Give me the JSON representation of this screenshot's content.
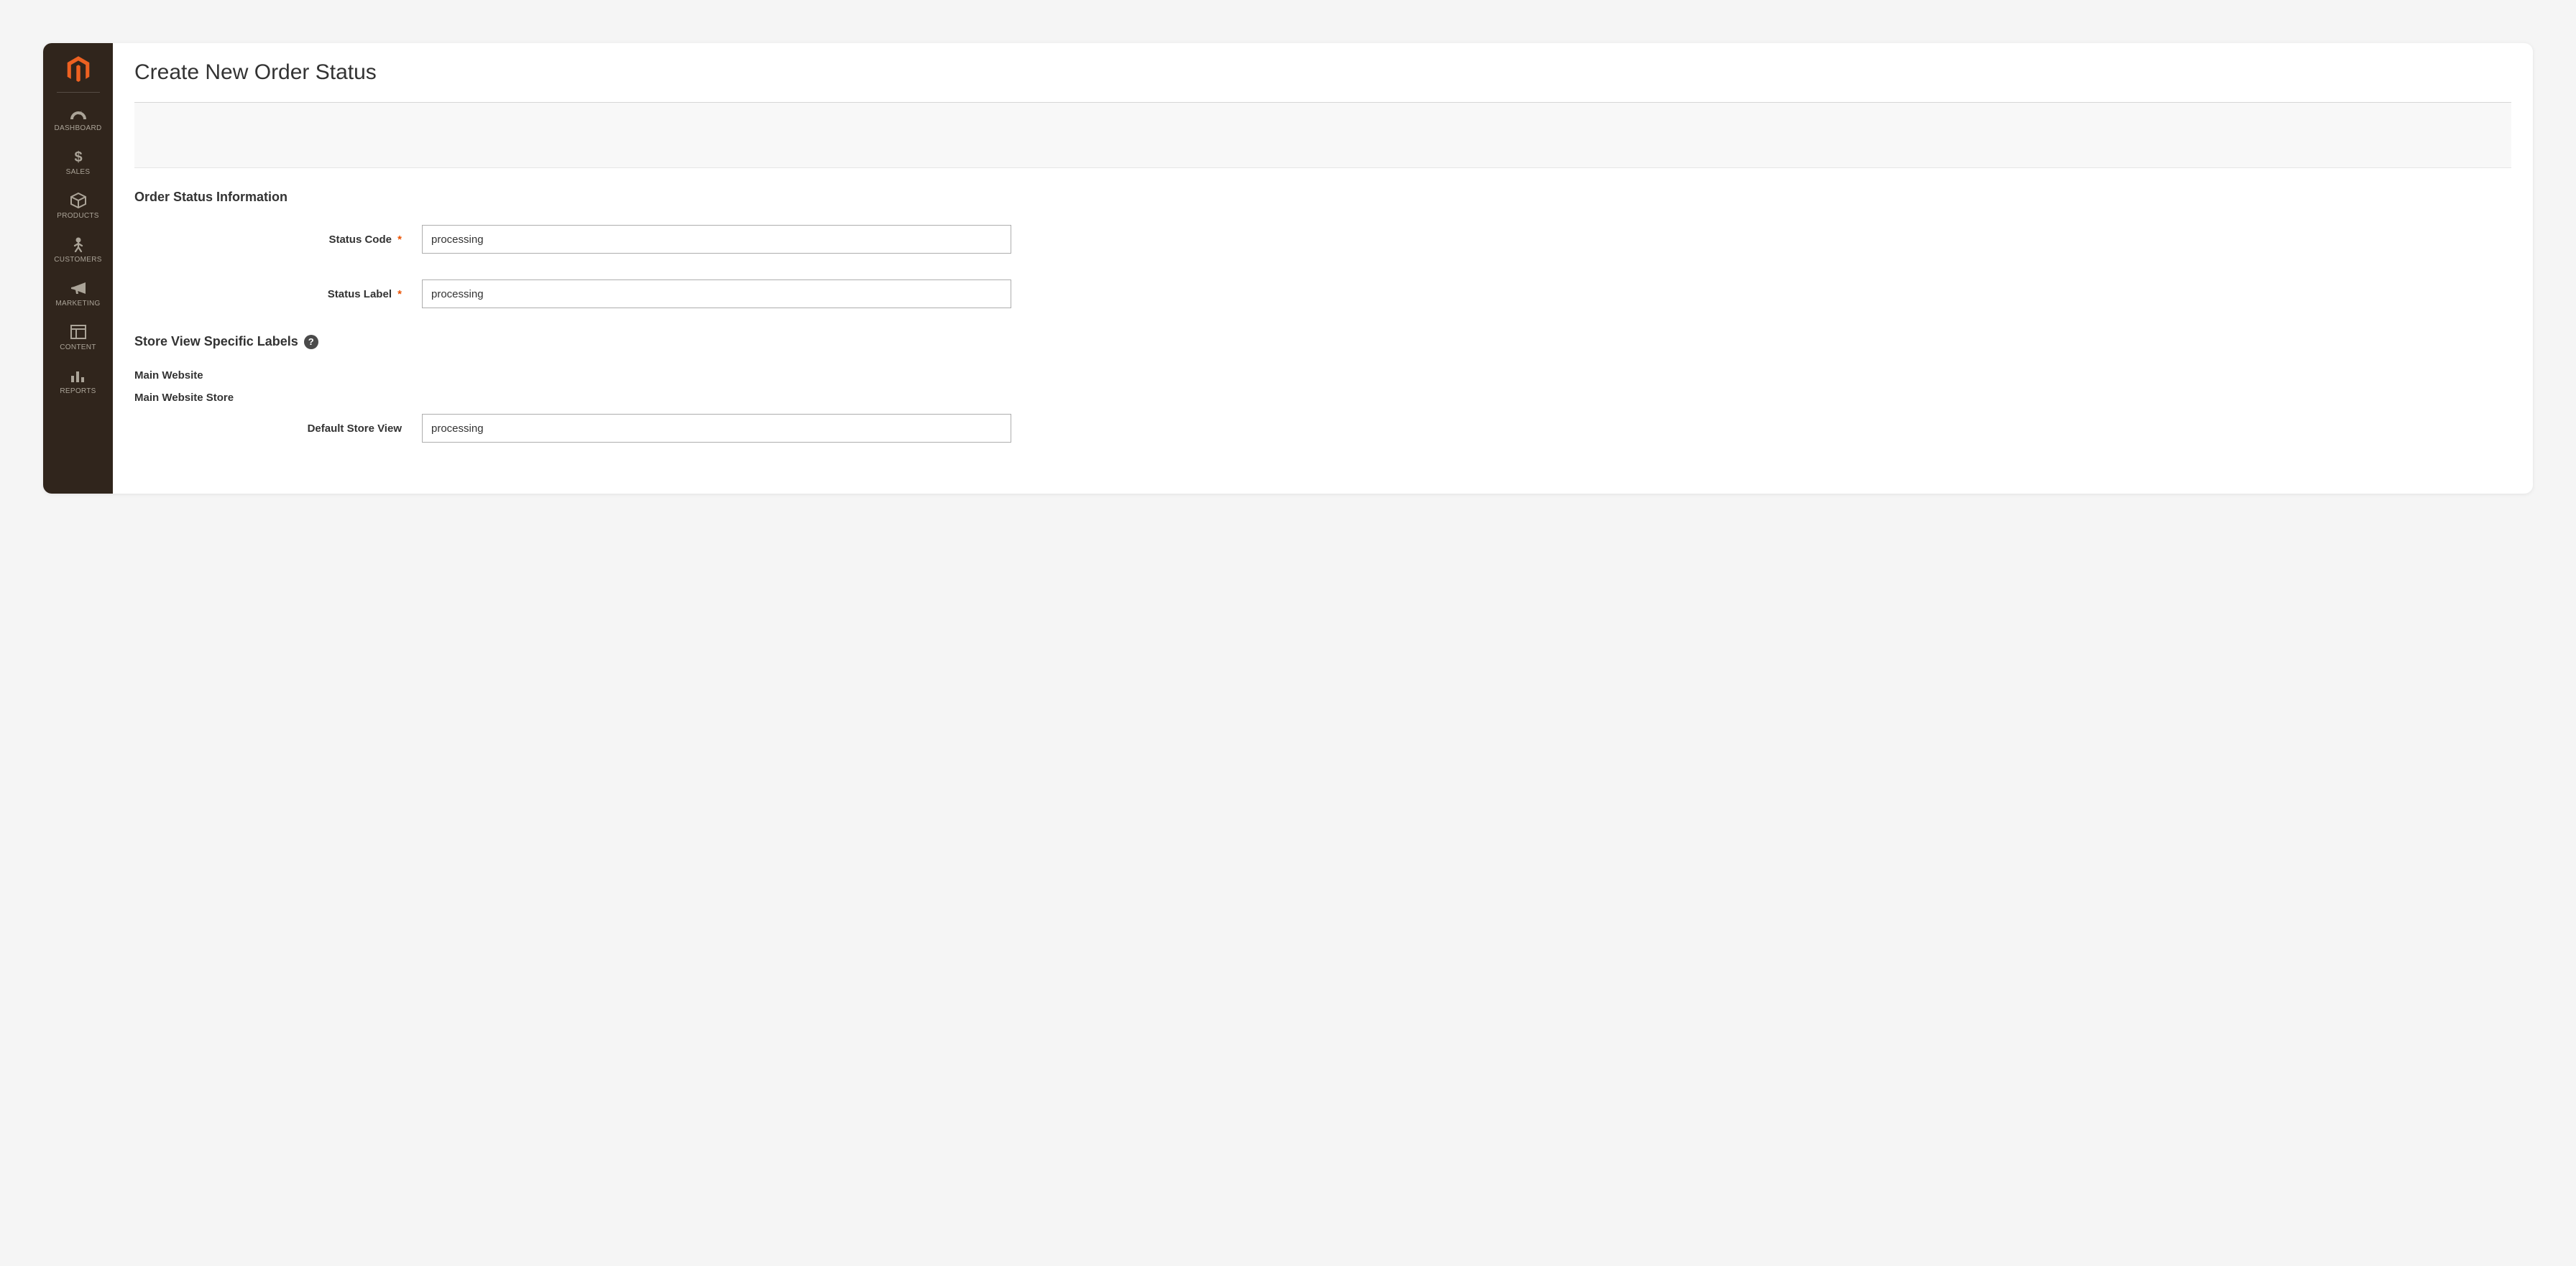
{
  "sidebar": {
    "items": [
      {
        "label": "DASHBOARD",
        "icon": "gauge"
      },
      {
        "label": "SALES",
        "icon": "dollar"
      },
      {
        "label": "PRODUCTS",
        "icon": "box"
      },
      {
        "label": "CUSTOMERS",
        "icon": "person"
      },
      {
        "label": "MARKETING",
        "icon": "megaphone"
      },
      {
        "label": "CONTENT",
        "icon": "layout"
      },
      {
        "label": "REPORTS",
        "icon": "bars"
      }
    ]
  },
  "page": {
    "title": "Create New Order Status"
  },
  "section_info_title": "Order Status Information",
  "fields": {
    "status_code": {
      "label": "Status Code",
      "value": "processing"
    },
    "status_label": {
      "label": "Status Label",
      "value": "processing"
    }
  },
  "store_view_section": {
    "title": "Store View Specific Labels",
    "website": "Main Website",
    "store": "Main Website Store",
    "default_view_label": "Default Store View",
    "default_view_value": "processing"
  },
  "req_glyph": "*",
  "help_glyph": "?"
}
